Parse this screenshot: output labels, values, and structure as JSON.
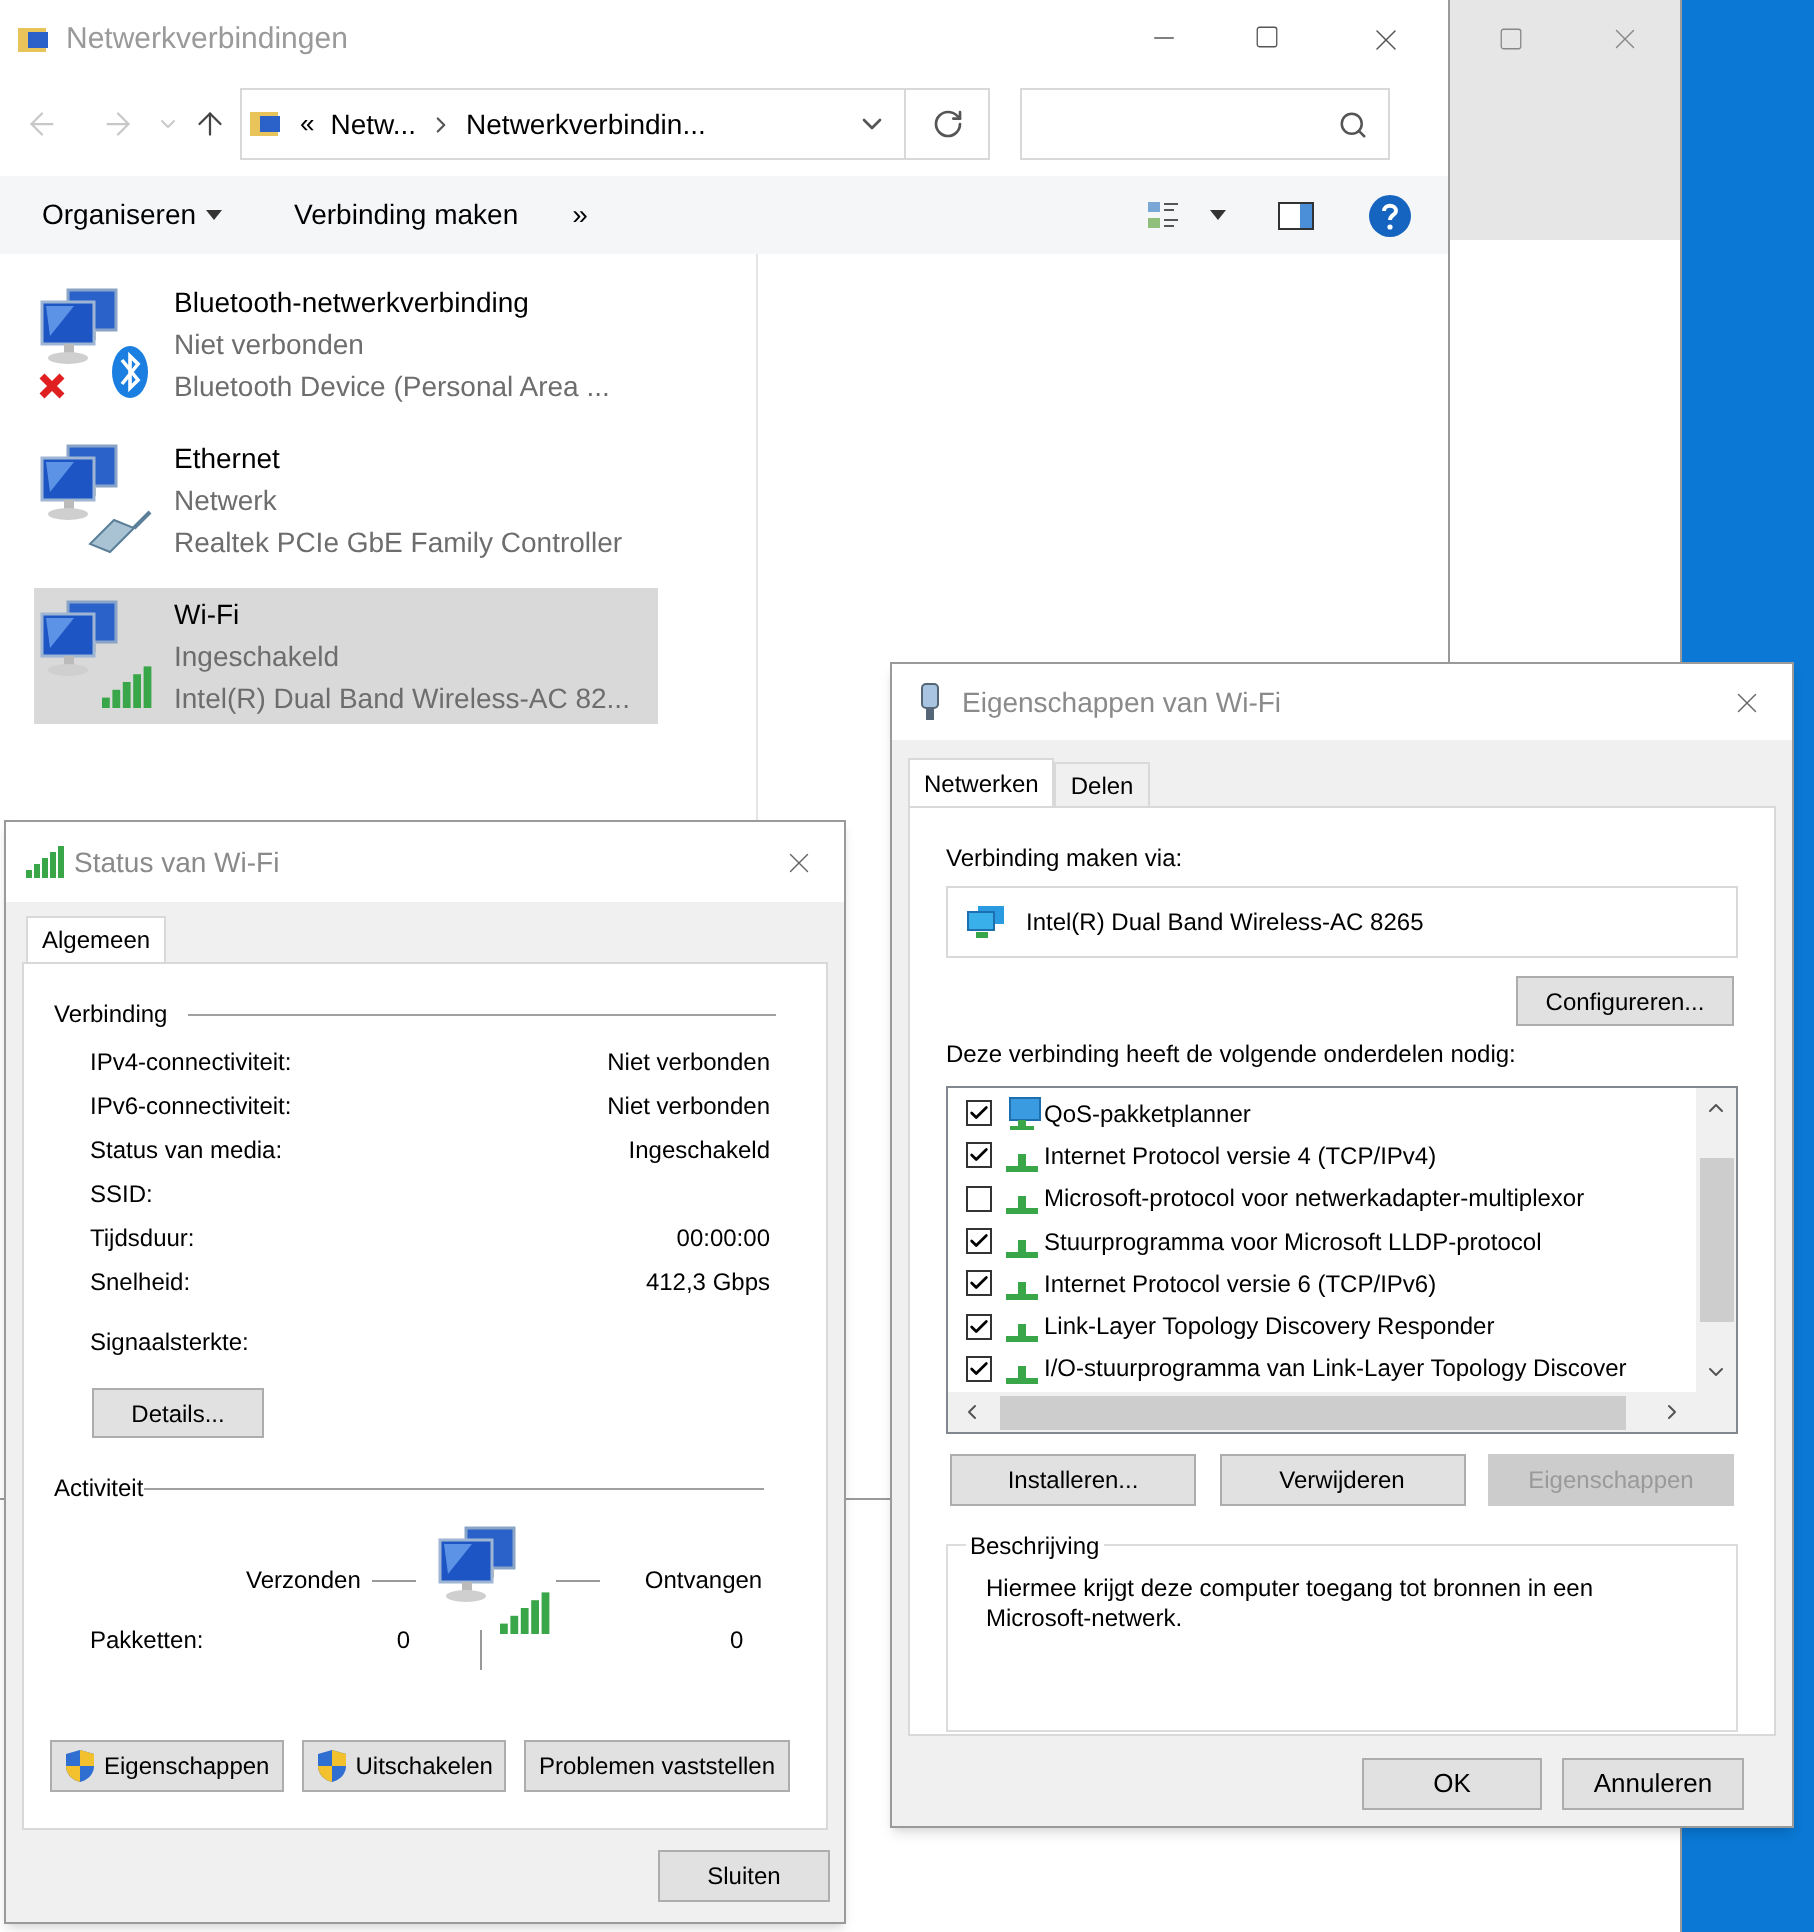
{
  "explorer": {
    "title": "Netwerkverbindingen",
    "address": {
      "overflow": "«",
      "crumbs": [
        "Netw...",
        "Netwerkverbindin..."
      ]
    },
    "toolbar": {
      "items": [
        {
          "label": "Organiseren",
          "dropdown": true
        },
        {
          "label": "Verbinding maken",
          "dropdown": false
        }
      ],
      "overflow": "»"
    },
    "connections": [
      {
        "name": "Bluetooth-netwerkverbinding",
        "status": "Niet verbonden",
        "device": "Bluetooth Device (Personal Area ...",
        "kind": "bluetooth",
        "disconnected": true,
        "selected": false
      },
      {
        "name": "Ethernet",
        "status": "Netwerk",
        "device": "Realtek PCIe GbE Family Controller",
        "kind": "ethernet",
        "disconnected": false,
        "selected": false
      },
      {
        "name": "Wi-Fi",
        "status": "Ingeschakeld",
        "device": "Intel(R) Dual Band Wireless-AC 82...",
        "kind": "wifi",
        "disconnected": false,
        "selected": true
      }
    ]
  },
  "status_dialog": {
    "title": "Status van Wi-Fi",
    "tabs": [
      {
        "label": "Algemeen",
        "selected": true
      }
    ],
    "connection_heading": "Verbinding",
    "rows": [
      {
        "label": "IPv4-connectiviteit:",
        "value": "Niet verbonden"
      },
      {
        "label": "IPv6-connectiviteit:",
        "value": "Niet verbonden"
      },
      {
        "label": "Status van media:",
        "value": "Ingeschakeld"
      },
      {
        "label": "SSID:"
      },
      {
        "label": "Tijdsduur:",
        "value": "00:00:00"
      },
      {
        "label": "Snelheid:",
        "value": "412,3 Gbps"
      }
    ],
    "signal_label": "Signaalsterkte:",
    "details_button": "Details...",
    "activity_heading": "Activiteit",
    "sent_label": "Verzonden",
    "received_label": "Ontvangen",
    "packets_label": "Pakketten:",
    "packets_sent": "0",
    "packets_received": "0",
    "buttons": [
      {
        "label": "Eigenschappen",
        "shield": true
      },
      {
        "label": "Uitschakelen",
        "shield": true
      },
      {
        "label": "Problemen vaststellen",
        "shield": false
      }
    ],
    "close_button": "Sluiten"
  },
  "properties_dialog": {
    "title": "Eigenschappen van Wi-Fi",
    "tabs": [
      {
        "label": "Netwerken",
        "selected": true
      },
      {
        "label": "Delen",
        "selected": false
      }
    ],
    "connect_via_label": "Verbinding maken via:",
    "adapter": "Intel(R) Dual Band Wireless-AC 8265",
    "configure_button": "Configureren...",
    "components_label": "Deze verbinding heeft de volgende onderdelen nodig:",
    "components": [
      {
        "label": "QoS-pakketplanner",
        "checked": true,
        "kind": "service"
      },
      {
        "label": "Internet Protocol versie 4 (TCP/IPv4)",
        "checked": true,
        "kind": "protocol"
      },
      {
        "label": "Microsoft-protocol voor netwerkadapter-multiplexor",
        "checked": false,
        "kind": "protocol"
      },
      {
        "label": "Stuurprogramma voor Microsoft LLDP-protocol",
        "checked": true,
        "kind": "protocol"
      },
      {
        "label": "Internet Protocol versie 6 (TCP/IPv6)",
        "checked": true,
        "kind": "protocol"
      },
      {
        "label": "Link-Layer Topology Discovery Responder",
        "checked": true,
        "kind": "protocol"
      },
      {
        "label": "I/O-stuurprogramma van Link-Layer Topology Discover",
        "checked": true,
        "kind": "protocol"
      }
    ],
    "buttons": [
      {
        "label": "Installeren...",
        "disabled": false
      },
      {
        "label": "Verwijderen",
        "disabled": false
      },
      {
        "label": "Eigenschappen",
        "disabled": true
      }
    ],
    "description_heading": "Beschrijving",
    "description": "Hiermee krijgt deze computer toegang tot bronnen in een Microsoft-netwerk.",
    "ok_button": "OK",
    "cancel_button": "Annuleren"
  }
}
